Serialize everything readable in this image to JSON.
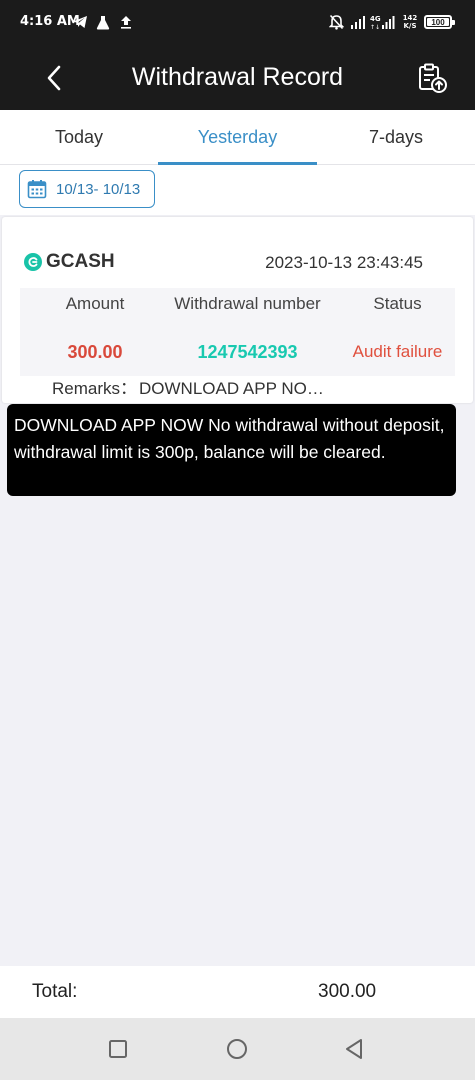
{
  "status_bar": {
    "time": "4:16 AM",
    "battery": "100",
    "icons": [
      "telegram-icon",
      "flask-icon",
      "upload-icon",
      "bell-off-icon",
      "signal-icon",
      "4g-signal-icon",
      "data-speed-icon",
      "battery-icon"
    ],
    "data_speed": "142",
    "data_speed_unit": "K/S",
    "network": "4G"
  },
  "header": {
    "title": "Withdrawal Record",
    "back_icon": "back-arrow-icon",
    "export_icon": "clipboard-upload-icon"
  },
  "tabs": [
    {
      "label": "Today",
      "active": false
    },
    {
      "label": "Yesterday",
      "active": true
    },
    {
      "label": "7-days",
      "active": false
    }
  ],
  "filter": {
    "date_range": "10/13- 10/13",
    "icon": "calendar-icon"
  },
  "record": {
    "method": "GCASH",
    "method_icon": "gcash-logo-icon",
    "datetime": "2023-10-13 23:43:45",
    "headers": {
      "amount": "Amount",
      "number": "Withdrawal number",
      "status": "Status"
    },
    "amount": "300.00",
    "number": "1247542393",
    "status": "Audit failure",
    "remarks_label": "Remarks：",
    "remarks_value": "DOWNLOAD APP NO…"
  },
  "tooltip": {
    "text": "DOWNLOAD APP NOW No withdrawal without deposit, withdrawal limit is 300p, balance will be cleared."
  },
  "footer": {
    "total_label": "Total:",
    "total_value": "300.00"
  },
  "nav": {
    "icons": [
      "recents-square-icon",
      "home-circle-icon",
      "back-triangle-icon"
    ]
  },
  "colors": {
    "header_bg": "#1b1b1b",
    "accent": "#3a8fc7",
    "amount": "#d9493b",
    "number": "#19c9b0",
    "status_fail": "#e0503e",
    "page_bg": "#f1f1f6"
  }
}
